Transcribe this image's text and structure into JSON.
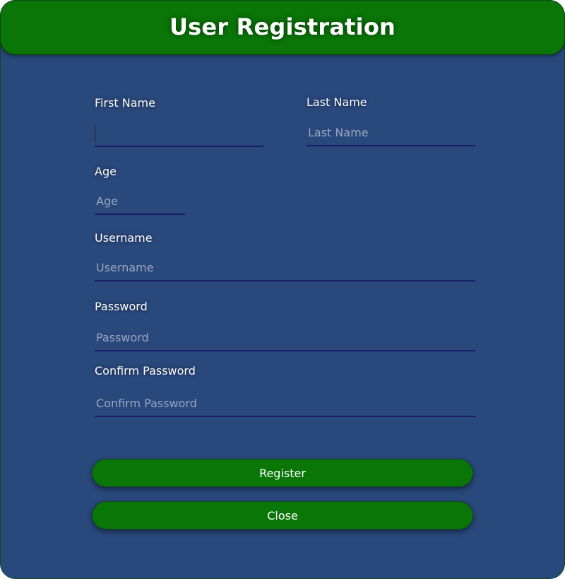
{
  "header": {
    "title": "User Registration"
  },
  "form": {
    "first_name": {
      "label": "First Name",
      "value": "",
      "placeholder": ""
    },
    "last_name": {
      "label": "Last Name",
      "value": "",
      "placeholder": "Last Name"
    },
    "age": {
      "label": "Age",
      "value": "",
      "placeholder": "Age"
    },
    "username": {
      "label": "Username",
      "value": "",
      "placeholder": "Username"
    },
    "password": {
      "label": "Password",
      "value": "",
      "placeholder": "Password"
    },
    "confirm_password": {
      "label": "Confirm Password",
      "value": "",
      "placeholder": "Confirm Password"
    }
  },
  "buttons": {
    "register_label": "Register",
    "close_label": "Close"
  },
  "colors": {
    "background": "#29487c",
    "accent_green": "#0a7608",
    "underline": "#1a1a6b",
    "placeholder": "#9aa6c0"
  }
}
